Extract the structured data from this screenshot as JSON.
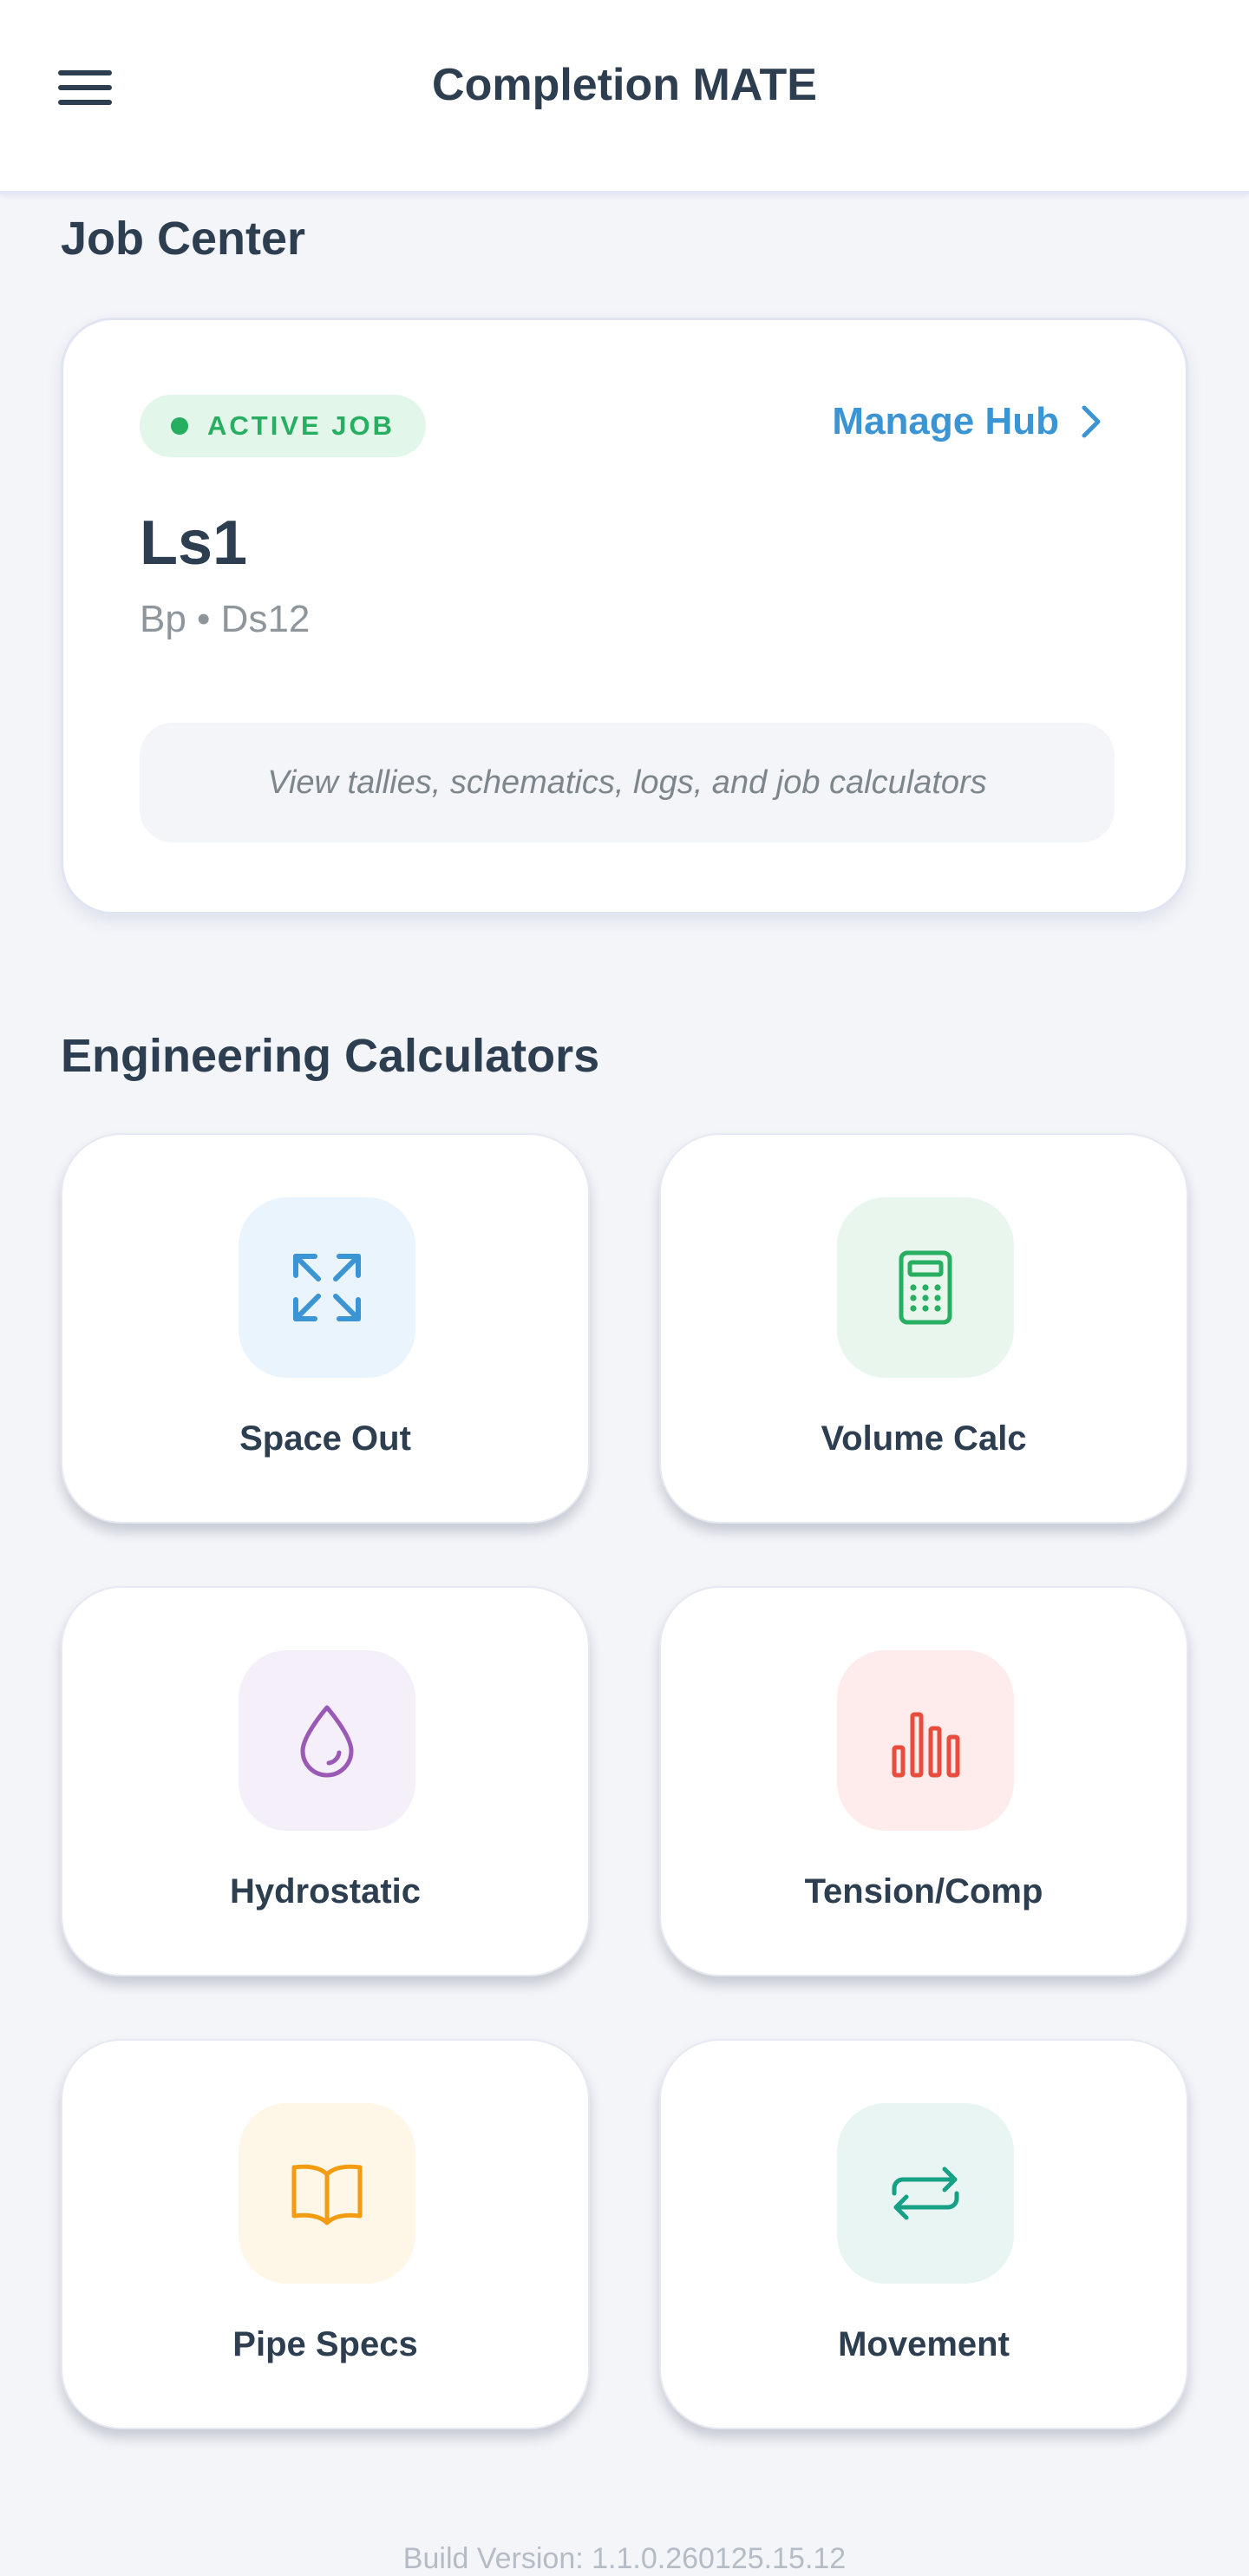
{
  "header": {
    "title": "Completion MATE",
    "menu_icon": "hamburger-icon"
  },
  "job_center": {
    "section_title": "Job Center",
    "badge": "ACTIVE JOB",
    "manage_link": "Manage Hub",
    "job_name": "Ls1",
    "job_meta": "Bp • Ds12",
    "hint": "View tallies, schematics, logs, and job calculators",
    "colors": {
      "badge_text": "#27ae60",
      "badge_bg": "#e3f6ea",
      "link": "#3b95d4"
    }
  },
  "calculators": {
    "section_title": "Engineering Calculators",
    "items": [
      {
        "label": "Space Out",
        "icon": "expand-arrows-icon",
        "color": "#3b95d4",
        "bg": "#eaf4fc"
      },
      {
        "label": "Volume Calc",
        "icon": "calculator-icon",
        "color": "#27ae60",
        "bg": "#e8f6ee"
      },
      {
        "label": "Hydrostatic",
        "icon": "droplet-icon",
        "color": "#9b59b6",
        "bg": "#f4eff8"
      },
      {
        "label": "Tension/Comp",
        "icon": "bar-chart-icon",
        "color": "#e74c3c",
        "bg": "#fdeceb"
      },
      {
        "label": "Pipe Specs",
        "icon": "open-book-icon",
        "color": "#f39c12",
        "bg": "#fef6e7"
      },
      {
        "label": "Movement",
        "icon": "repeat-arrows-icon",
        "color": "#16a085",
        "bg": "#e8f5f2"
      }
    ]
  },
  "footer": {
    "build_version": "Build Version: 1.1.0.260125.15.12"
  }
}
